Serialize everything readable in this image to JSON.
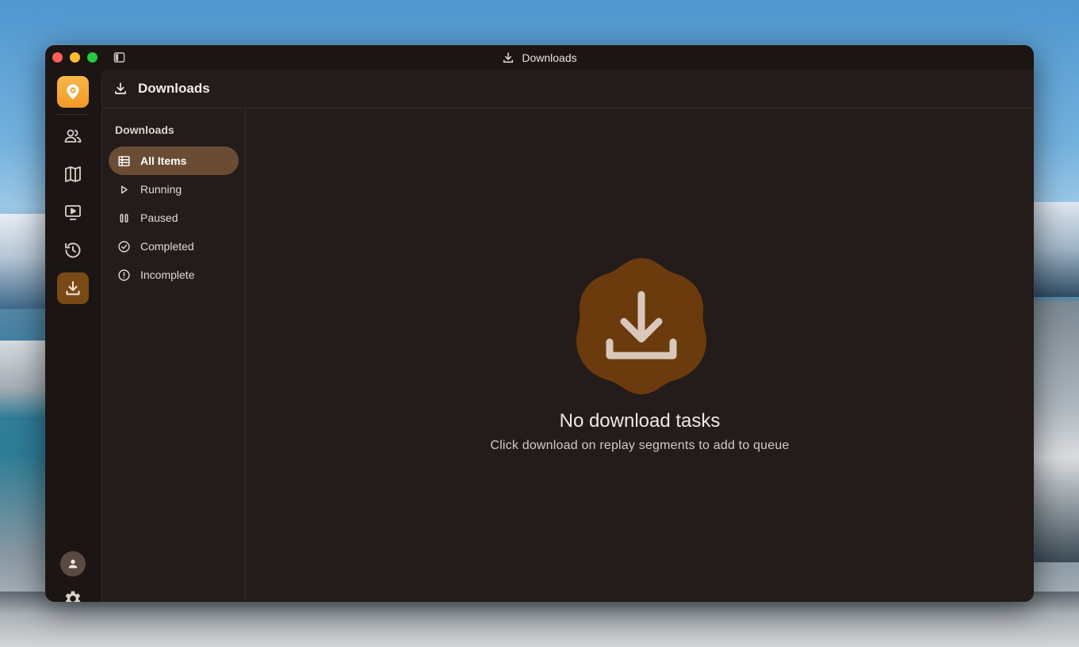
{
  "window": {
    "title": "Downloads"
  },
  "header": {
    "title": "Downloads"
  },
  "subnav": {
    "title": "Downloads",
    "items": [
      {
        "label": "All Items",
        "icon": "table-icon",
        "active": true
      },
      {
        "label": "Running",
        "icon": "play-icon",
        "active": false
      },
      {
        "label": "Paused",
        "icon": "pause-icon",
        "active": false
      },
      {
        "label": "Completed",
        "icon": "check-circle-icon",
        "active": false
      },
      {
        "label": "Incomplete",
        "icon": "alert-circle-icon",
        "active": false
      }
    ]
  },
  "rail": {
    "items": [
      "app-logo-icon",
      "people-icon",
      "map-icon",
      "replay-icon",
      "history-icon",
      "downloads-icon"
    ],
    "active": "downloads-icon"
  },
  "empty_state": {
    "title": "No download tasks",
    "subtitle": "Click download on replay segments to add to queue"
  },
  "colors": {
    "accent": "#7a4a16",
    "logo": "#f29a25",
    "active_nav": "#6a4c35",
    "background": "#231c1a"
  }
}
